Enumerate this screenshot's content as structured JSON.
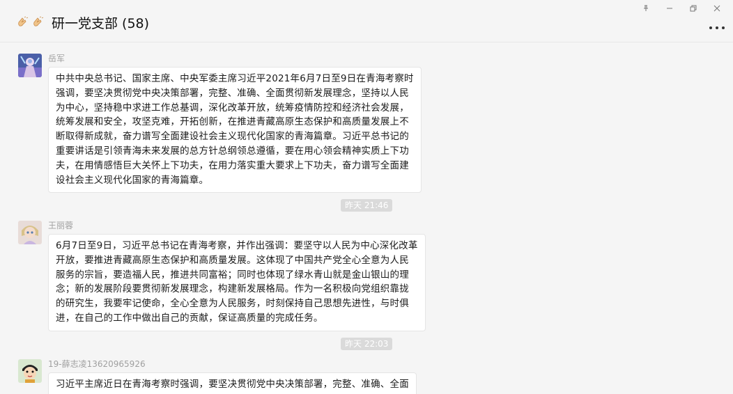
{
  "header": {
    "title": "研一党支部 (58)",
    "icons": [
      "clapping-hands-icon",
      "clapping-hands-icon"
    ]
  },
  "window_controls": [
    "pin-icon",
    "minimize-icon",
    "restore-icon",
    "close-icon"
  ],
  "messages": [
    {
      "sender": "岳军",
      "avatar": "anime-character-avatar",
      "lines": [
        "中共中央总书记、国家主席、中央军委主席习近平2021年6月7日至9日在青海考察时",
        "强调，要坚决贯彻党中央决策部署，完整、准确、全面贯彻新发展理念，坚持以人民",
        "为中心，坚持稳中求进工作总基调，深化改革开放，统筹疫情防控和经济社会发展，",
        "统筹发展和安全，攻坚克难，开拓创新，在推进青藏高原生态保护和高质量发展上不",
        "断取得新成就，奋力谱写全面建设社会主义现代化国家的青海篇章。习近平总书记的",
        "重要讲话是引领青海未来发展的总方针总纲领总遵循，要在用心领会精神实质上下功",
        "夫，在用情感悟巨大关怀上下功夫，在用力落实重大要求上下功夫，奋力谱写全面建",
        "设社会主义现代化国家的青海篇章。"
      ]
    },
    {
      "sender": "王丽蓉",
      "avatar": "doll-avatar",
      "lines": [
        "6月7日至9日，习近平总书记在青海考察，并作出强调：要坚守以人民为中心深化改革",
        "开放，要推进青藏高原生态保护和高质量发展。这体现了中国共产党全心全意为人民",
        "服务的宗旨，要造福人民，推进共同富裕；同时也体现了绿水青山就是金山银山的理",
        "念；新的发展阶段要贯彻新发展理念，构建新发展格局。作为一名积极向党组织靠拢",
        "的研究生，我要牢记使命，全心全意为人民服务，时刻保持自己思想先进性，与时俱",
        "进，在自己的工作中做出自己的贡献，保证高质量的完成任务。"
      ]
    },
    {
      "sender": "19-薛志凌13620965926",
      "avatar": "cartoon-boy-avatar",
      "lines": [
        "习近平主席近日在青海考察时强调，要坚决贯彻党中央决策部署，完整、准确、全面"
      ]
    }
  ],
  "timestamps": [
    "昨天 21:46",
    "昨天 22:03"
  ]
}
